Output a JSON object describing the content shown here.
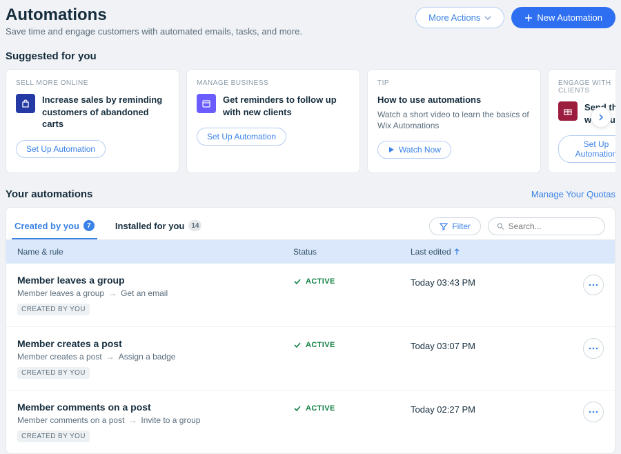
{
  "header": {
    "title": "Automations",
    "subtitle": "Save time and engage customers with automated emails, tasks, and more.",
    "more_actions": "More Actions",
    "new_automation": "New Automation"
  },
  "suggested_title": "Suggested for you",
  "cards": [
    {
      "eyebrow": "SELL MORE ONLINE",
      "title": "Increase sales by reminding customers of abandoned carts",
      "desc": "",
      "cta": "Set Up Automation",
      "icon_bg": "#2439a3",
      "icon": "bag"
    },
    {
      "eyebrow": "MANAGE BUSINESS",
      "title": "Get reminders to follow up with new clients",
      "desc": "",
      "cta": "Set Up Automation",
      "icon_bg": "#6a5cff",
      "icon": "calendar"
    },
    {
      "eyebrow": "TIP",
      "title": "How to use automations",
      "desc": "Watch a short video to learn the basics of Wix Automations",
      "cta": "Watch Now",
      "cta_kind": "play",
      "icon_bg": "",
      "icon": ""
    },
    {
      "eyebrow": "ENGAGE WITH CLIENTS",
      "title": "Send thank who su",
      "desc": "",
      "cta": "Set Up Automation",
      "icon_bg": "#9c1e3f",
      "icon": "gift"
    }
  ],
  "your_section": {
    "title": "Your automations",
    "quota": "Manage Your Quotas"
  },
  "tabs": {
    "created": "Created by you",
    "created_count": "7",
    "installed": "Installed for you",
    "installed_count": "14"
  },
  "toolbar": {
    "filter": "Filter",
    "search_placeholder": "Search..."
  },
  "columns": {
    "name": "Name & rule",
    "status": "Status",
    "edited": "Last edited"
  },
  "rows": [
    {
      "title": "Member leaves a group",
      "trigger": "Member leaves a group",
      "action": "Get an email",
      "status": "ACTIVE",
      "edited": "Today 03:43 PM",
      "tag": "CREATED BY YOU"
    },
    {
      "title": "Member creates a post",
      "trigger": "Member creates a post",
      "action": "Assign a badge",
      "status": "ACTIVE",
      "edited": "Today 03:07 PM",
      "tag": "CREATED BY YOU"
    },
    {
      "title": "Member comments on a post",
      "trigger": "Member comments on a post",
      "action": "Invite to a group",
      "status": "ACTIVE",
      "edited": "Today 02:27 PM",
      "tag": "CREATED BY YOU"
    }
  ]
}
